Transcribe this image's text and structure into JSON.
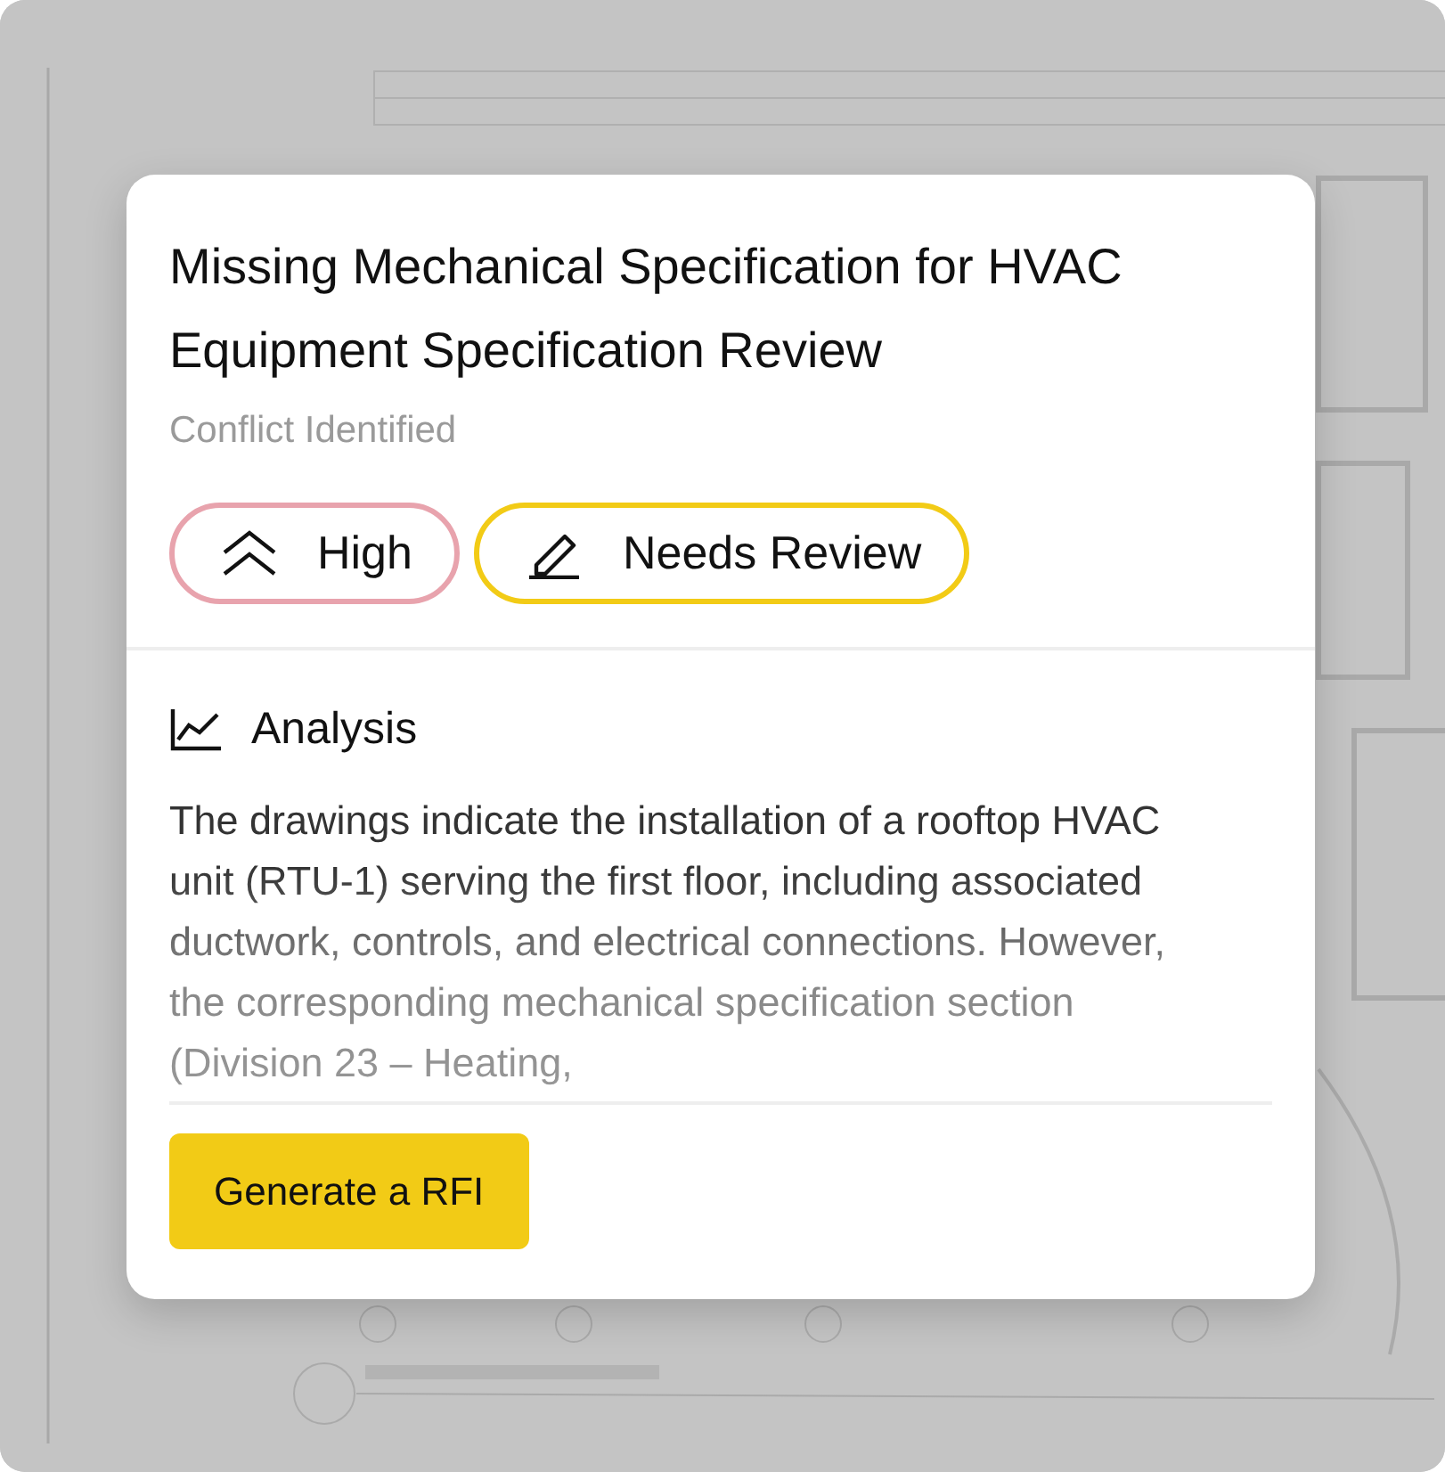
{
  "dialog": {
    "title": "Missing Mechanical Specification for HVAC Equipment Specification Review",
    "subtitle": "Conflict Identified",
    "tags": [
      {
        "kind": "priority",
        "label": "High",
        "color": "#e8a3ad"
      },
      {
        "kind": "status",
        "label": "Needs Review",
        "color": "#f2cb16"
      }
    ],
    "section": {
      "heading": "Analysis",
      "text": "The drawings indicate the installation of a rooftop HVAC unit (RTU-1) serving the first floor, including associated ductwork, controls, and electrical connections. However, the corresponding mechanical specification section (Division 23 – Heating,"
    },
    "button": "Generate a RFI"
  }
}
